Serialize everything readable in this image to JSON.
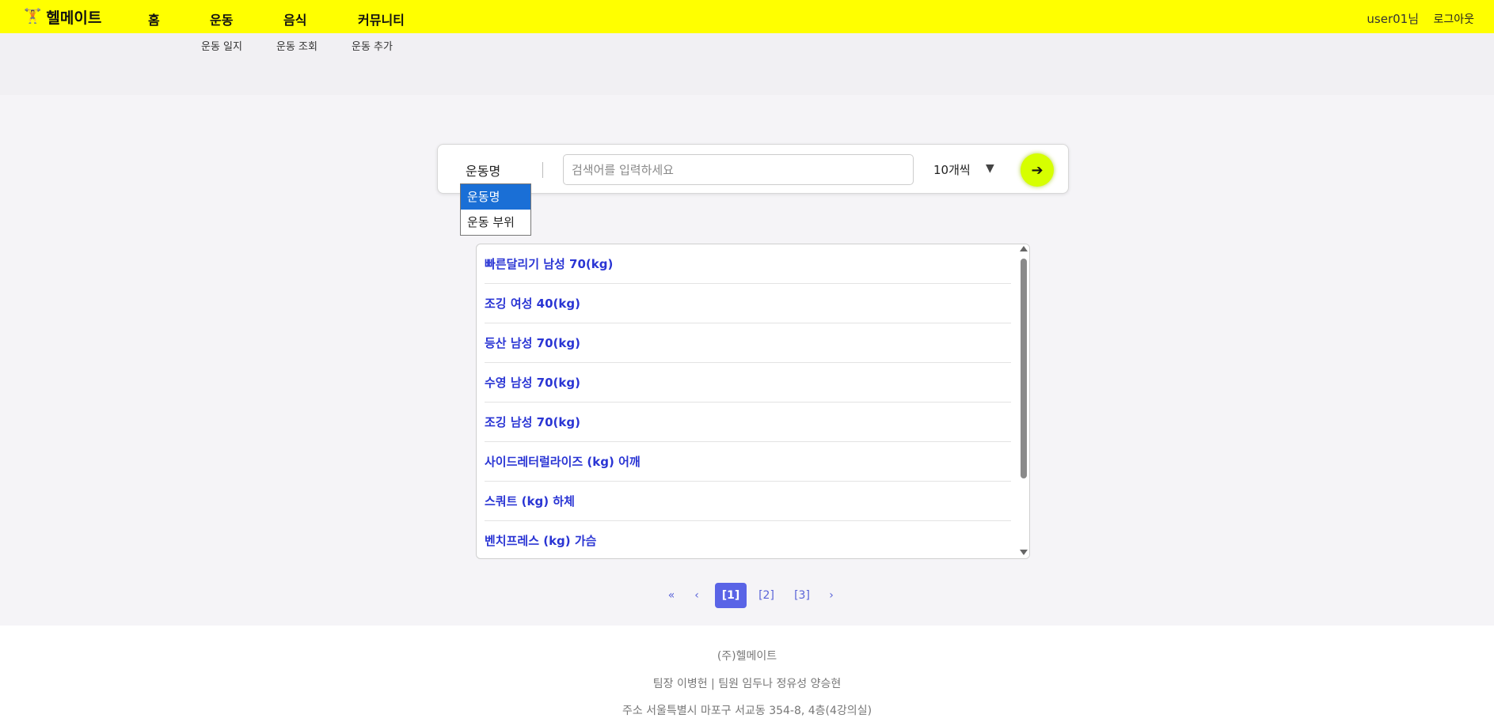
{
  "header": {
    "logo_icon": "🏋",
    "logo_text": "헬메이트",
    "nav": [
      "홈",
      "운동",
      "음식",
      "커뮤니티"
    ],
    "user": "user01님",
    "logout": "로그아웃"
  },
  "subnav": [
    "운동 일지",
    "운동 조회",
    "운동 추가"
  ],
  "search": {
    "type_selected": "운동명",
    "placeholder": "검색어를 입력하세요",
    "value": "",
    "count": "10개씩",
    "count_arrow": "▼",
    "go_icon": "➔",
    "type_options": [
      "운동명",
      "운동 부위"
    ]
  },
  "results": [
    "빠른달리기 남성 70(kg)",
    "조깅 여성 40(kg)",
    "등산 남성 70(kg)",
    "수영 남성 70(kg)",
    "조깅 남성 70(kg)",
    "사이드레터럴라이즈 (kg) 어깨",
    "스쿼트 (kg) 하체",
    "벤치프레스 (kg) 가슴"
  ],
  "pagination": {
    "first": "«",
    "prev": "‹",
    "pages": [
      "[1]",
      "[2]",
      "[3]"
    ],
    "active": 0,
    "next": "›"
  },
  "footer": [
    "(주)헬메이트",
    "팀장 이병헌 | 팀원 임두나 정유성 양승현",
    "주소 서울특별시 마포구 서교동 354-8, 4층(4강의실)"
  ],
  "colors": {
    "header_bg": "#ffff00",
    "go_button": "#d6ff00",
    "link": "#2a35d4",
    "page_active": "#5a64e6",
    "dropdown_selected": "#1a6fd6"
  }
}
